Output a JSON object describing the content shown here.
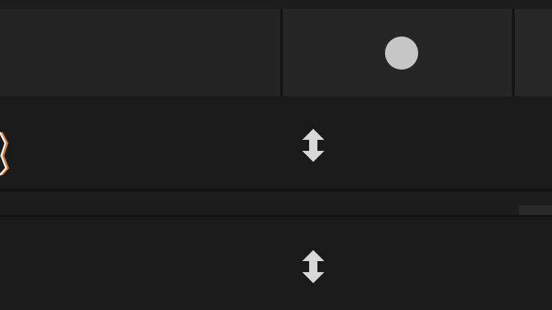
{
  "header": {
    "columns": [
      "",
      "",
      ""
    ],
    "status_indicator": {
      "icon": "circle-indicator-icon",
      "color": "#c6c6c6"
    }
  },
  "rows": [
    {
      "leading_icon": "chevron-expand-icon",
      "action_icon": "vertical-resize-icon"
    },
    {
      "leading_icon": "",
      "action_icon": "vertical-resize-icon"
    }
  ],
  "colors": {
    "background": "#1b1b1b",
    "header": "#262626",
    "icon": "#d8d8d8",
    "accent": "#e07a1f"
  }
}
